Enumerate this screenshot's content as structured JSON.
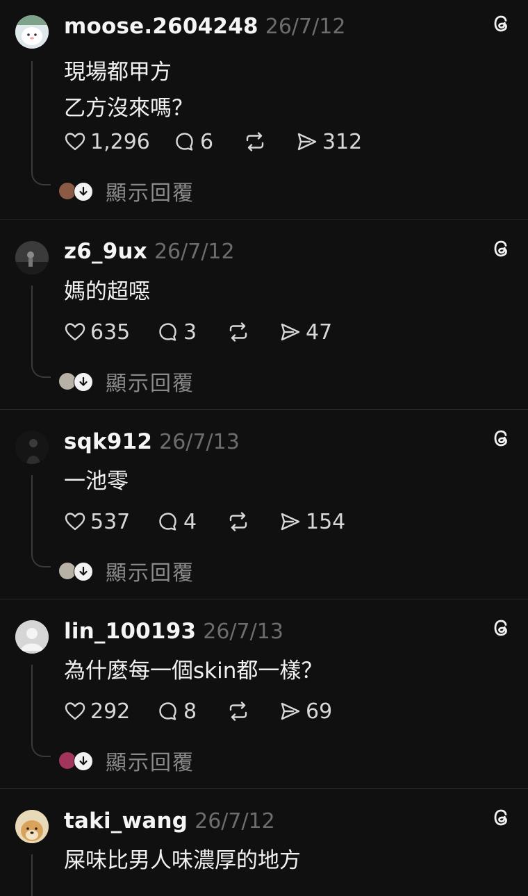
{
  "icons": {
    "like": "heart-icon",
    "comment": "comment-icon",
    "repost": "repost-icon",
    "share": "share-icon",
    "threads": "threads-logo-icon",
    "expand": "arrow-down-icon"
  },
  "colors": {
    "background": "#101010",
    "username": "#f5f5f5",
    "timestamp": "#6d6d6d",
    "muted": "#8a8a8a"
  },
  "posts": [
    {
      "username": "moose.2604248",
      "timestamp": "26/7/12",
      "text": "現場都甲方\n乙方沒來嗎？",
      "likes": "1,296",
      "comments": "6",
      "shares": "312",
      "show_replies": "顯示回覆"
    },
    {
      "username": "z6_9ux",
      "timestamp": "26/7/12",
      "text": "媽的超噁",
      "likes": "635",
      "comments": "3",
      "shares": "47",
      "show_replies": "顯示回覆"
    },
    {
      "username": "sqk912",
      "timestamp": "26/7/13",
      "text": "一池零",
      "likes": "537",
      "comments": "4",
      "shares": "154",
      "show_replies": "顯示回覆"
    },
    {
      "username": "lin_100193",
      "timestamp": "26/7/13",
      "text": "為什麼每一個skin都一樣？",
      "likes": "292",
      "comments": "8",
      "shares": "69",
      "show_replies": "顯示回覆"
    },
    {
      "username": "taki_wang",
      "timestamp": "26/7/12",
      "text": "屎味比男人味濃厚的地方"
    }
  ]
}
